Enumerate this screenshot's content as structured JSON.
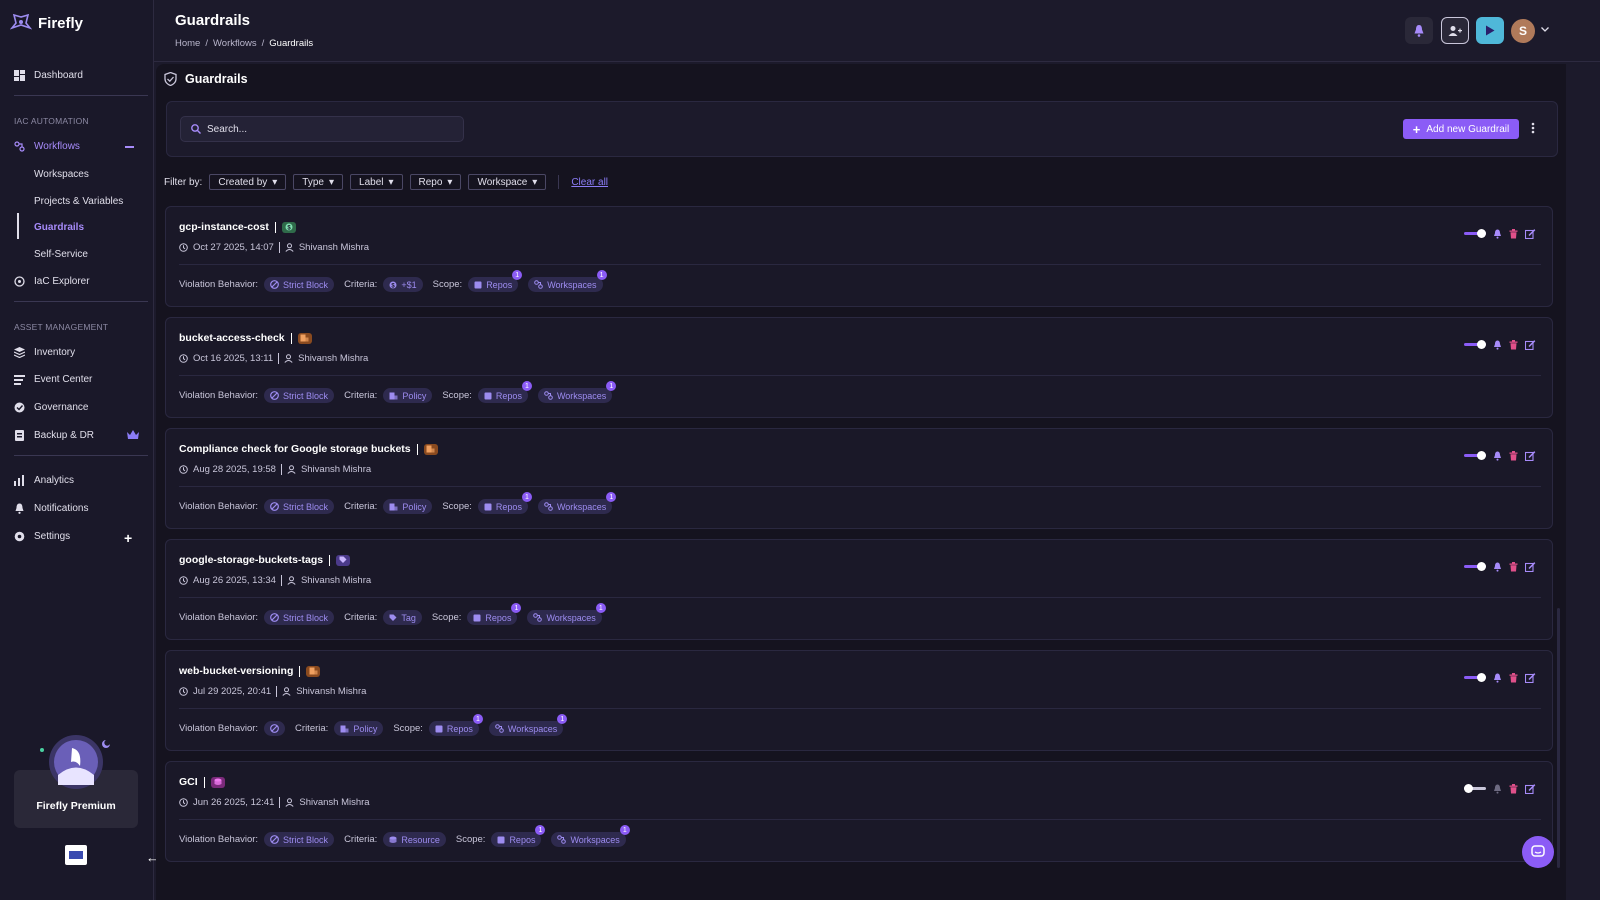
{
  "app": {
    "name": "Firefly"
  },
  "header": {
    "title": "Guardrails",
    "breadcrumb": [
      "Home",
      "/",
      "Workflows",
      "/",
      "Guardrails"
    ],
    "avatar_initial": "S"
  },
  "sidebar": {
    "dashboard": "Dashboard",
    "section_iac": "IAC AUTOMATION",
    "workflows": "Workflows",
    "sub_items": [
      "Workspaces",
      "Projects & Variables",
      "Guardrails",
      "Self-Service"
    ],
    "iac_explorer": "IaC Explorer",
    "section_asset": "ASSET MANAGEMENT",
    "inventory": "Inventory",
    "event_center": "Event Center",
    "governance": "Governance",
    "backup": "Backup & DR",
    "analytics": "Analytics",
    "notifications": "Notifications",
    "settings": "Settings",
    "premium": "Firefly Premium"
  },
  "page": {
    "title": "Guardrails",
    "search_placeholder": "Search...",
    "add_button": "Add new Guardrail",
    "filter_label": "Filter by:",
    "filters": [
      "Created by",
      "Type",
      "Label",
      "Repo",
      "Workspace"
    ],
    "clear_all": "Clear all"
  },
  "labels": {
    "violation": "Violation Behavior:",
    "criteria": "Criteria:",
    "scope": "Scope:",
    "repos": "Repos",
    "workspaces": "Workspaces"
  },
  "guardrails": [
    {
      "name": "gcp-instance-cost",
      "badge": "cost",
      "date": "Oct 27 2025, 14:07",
      "author": "Shivansh Mishra",
      "violation": "Strict Block",
      "criteria": "+$1",
      "criteria_icon": "cost",
      "repos_count": "1",
      "workspaces_count": "1",
      "enabled": true
    },
    {
      "name": "bucket-access-check",
      "badge": "policy",
      "date": "Oct 16 2025, 13:11",
      "author": "Shivansh Mishra",
      "violation": "Strict Block",
      "criteria": "Policy",
      "criteria_icon": "policy",
      "repos_count": "1",
      "workspaces_count": "1",
      "enabled": true
    },
    {
      "name": "Compliance check for Google storage buckets",
      "badge": "policy",
      "date": "Aug 28 2025, 19:58",
      "author": "Shivansh Mishra",
      "violation": "Strict Block",
      "criteria": "Policy",
      "criteria_icon": "policy",
      "repos_count": "1",
      "workspaces_count": "1",
      "enabled": true
    },
    {
      "name": "google-storage-buckets-tags",
      "badge": "tag",
      "date": "Aug 26 2025, 13:34",
      "author": "Shivansh Mishra",
      "violation": "Strict Block",
      "criteria": "Tag",
      "criteria_icon": "tag",
      "repos_count": "1",
      "workspaces_count": "1",
      "enabled": true
    },
    {
      "name": "web-bucket-versioning",
      "badge": "policy",
      "date": "Jul 29 2025, 20:41",
      "author": "Shivansh Mishra",
      "violation": "",
      "criteria": "Policy",
      "criteria_icon": "policy",
      "repos_count": "1",
      "workspaces_count": "1",
      "enabled": true
    },
    {
      "name": "GCI",
      "badge": "resource",
      "date": "Jun 26 2025, 12:41",
      "author": "Shivansh Mishra",
      "violation": "Strict Block",
      "criteria": "Resource",
      "criteria_icon": "resource",
      "repos_count": "1",
      "workspaces_count": "1",
      "enabled": false
    }
  ],
  "colors": {
    "accent": "#8b5cf6",
    "accent_text": "#a78bfa",
    "badge_cost": "#2f6b4a",
    "badge_policy": "#8a4a1f",
    "badge_tag": "#4b3a8a",
    "badge_resource": "#7a2a7a"
  }
}
